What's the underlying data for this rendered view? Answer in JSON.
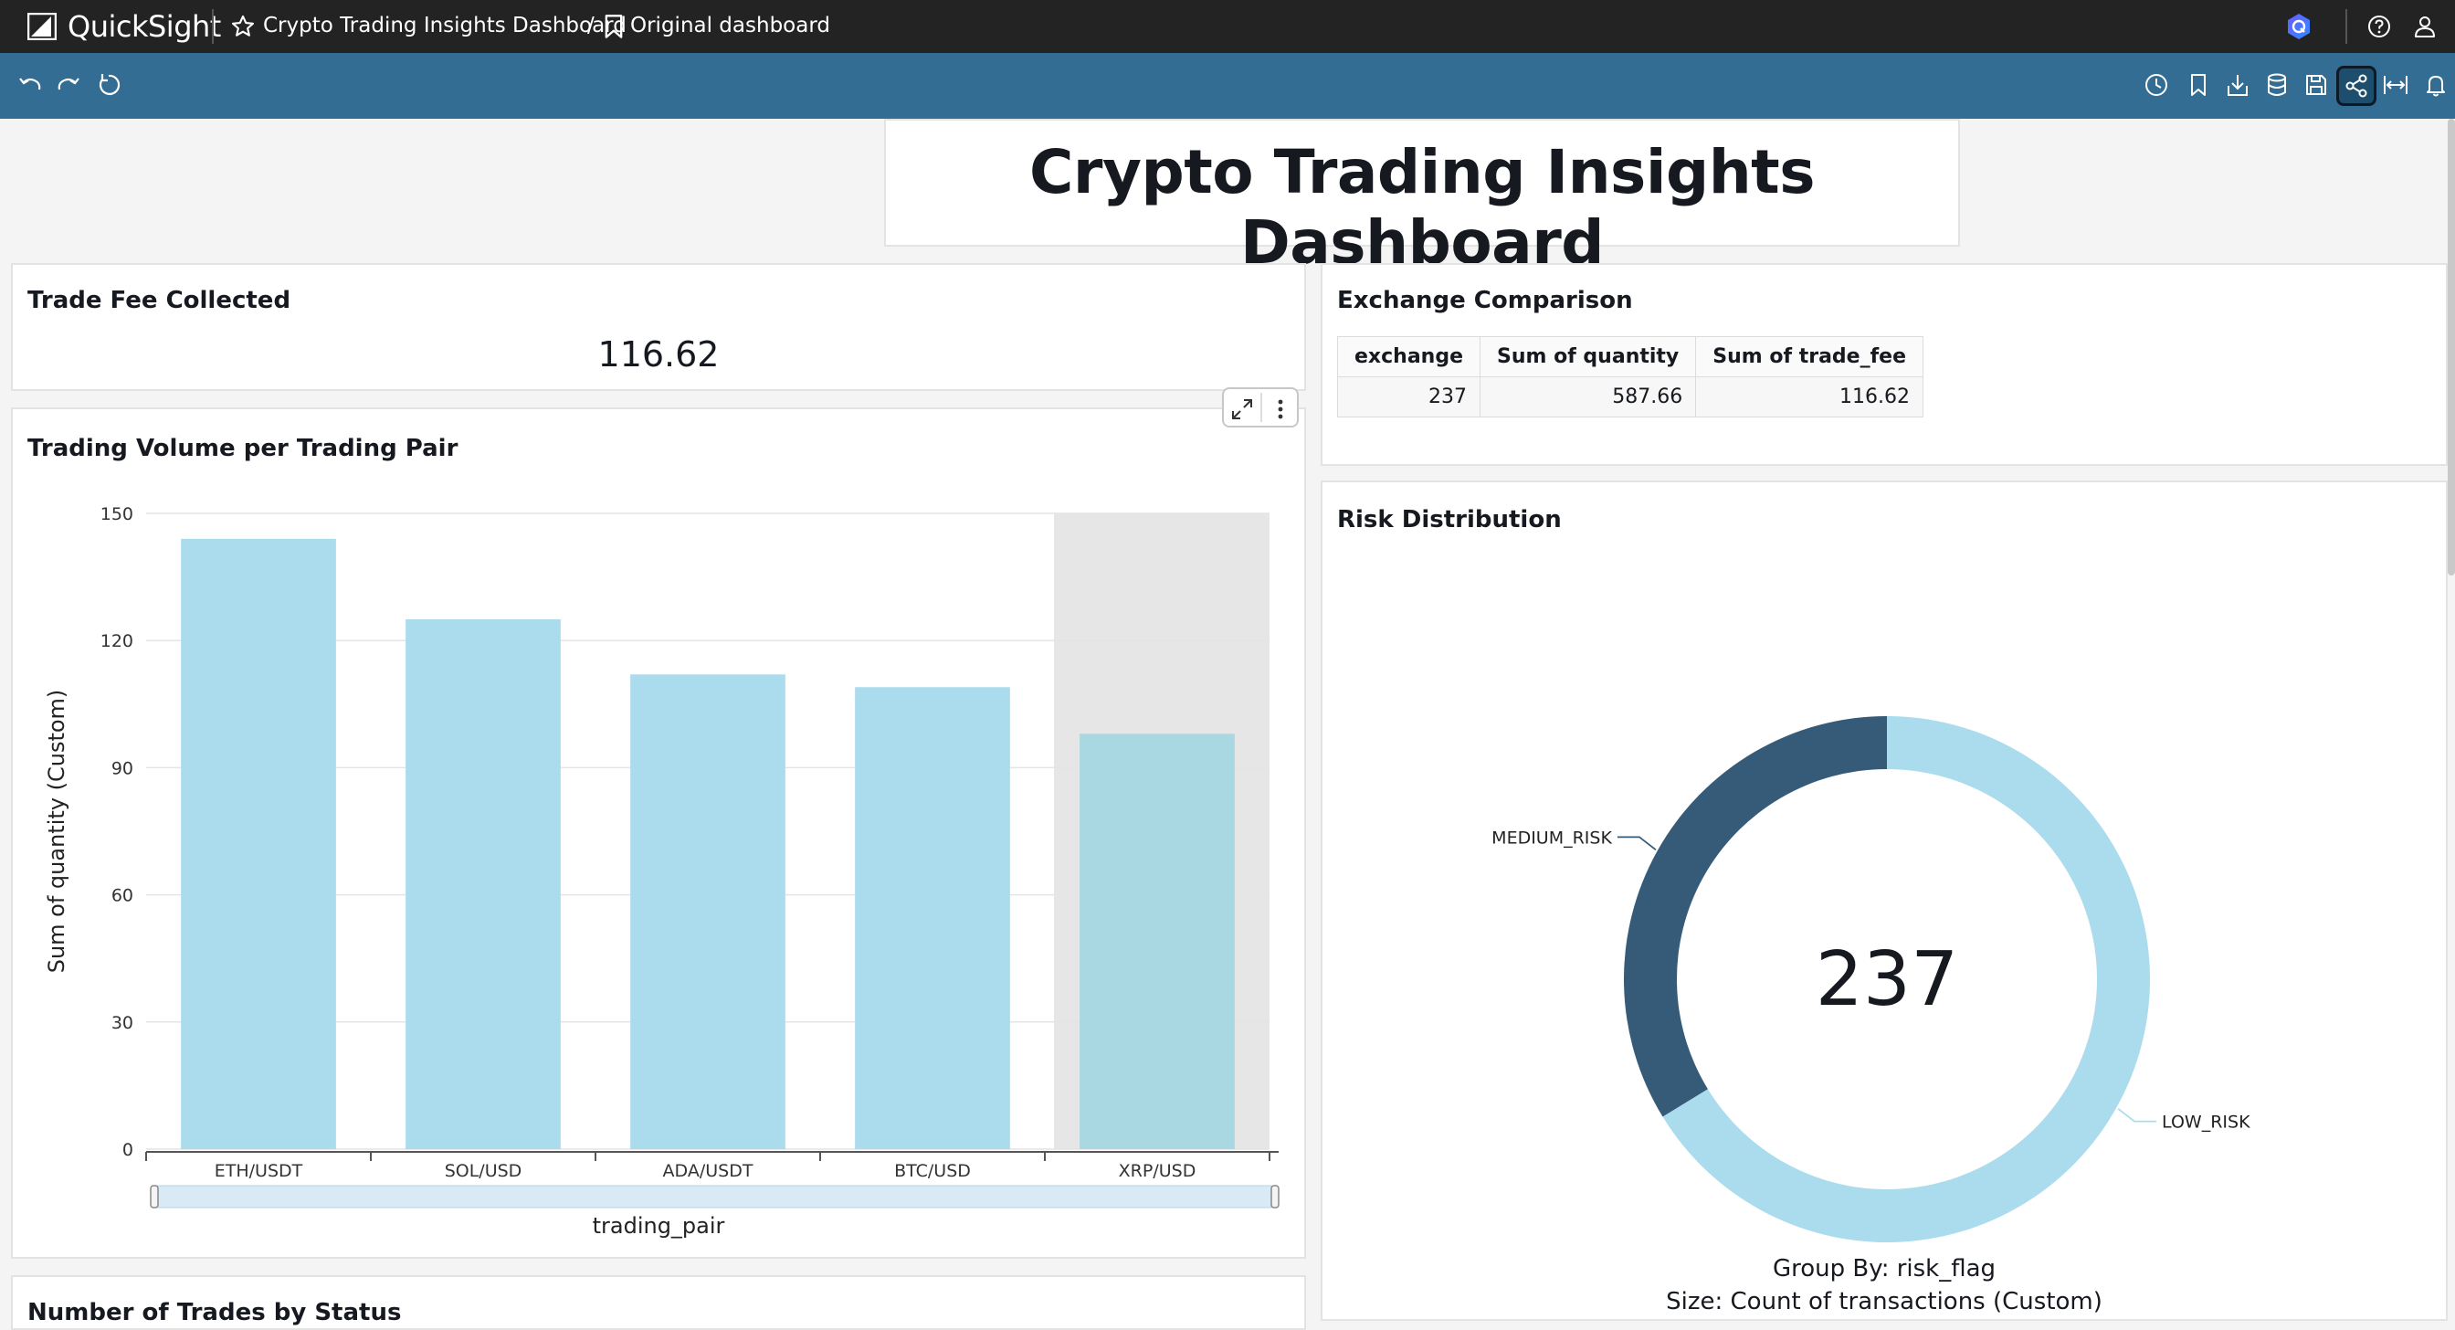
{
  "app": {
    "name": "QuickSight"
  },
  "breadcrumb": {
    "analysis_name": "Crypto Trading Insights Dashboard",
    "separator": "/",
    "sheet_name": "Original dashboard"
  },
  "header_icons": [
    "favorite-star-icon",
    "bookmark-icon",
    "amazon-q-icon",
    "help-icon",
    "user-icon"
  ],
  "toolbar_icons": [
    "undo-icon",
    "redo-icon",
    "reset-icon",
    "schedule-icon",
    "bookmark-icon",
    "export-icon",
    "dataset-icon",
    "save-icon",
    "share-icon",
    "fit-width-icon",
    "alert-icon"
  ],
  "dashboard": {
    "title": "Crypto Trading Insights Dashboard"
  },
  "kpi": {
    "title": "Trade Fee Collected",
    "value": "116.62"
  },
  "exchange_table": {
    "title": "Exchange Comparison",
    "columns": [
      "exchange",
      "Sum of quantity",
      "Sum of trade_fee"
    ],
    "rows": [
      [
        "237",
        "587.66",
        "116.62"
      ]
    ]
  },
  "bar_visual": {
    "title": "Trading Volume per Trading Pair",
    "controls": [
      "expand-icon",
      "more-options-icon"
    ]
  },
  "risk_visual": {
    "title": "Risk Distribution",
    "center_value": "237",
    "group_by_text": "Group By: risk_flag",
    "size_text": "Size: Count of transactions (Custom)"
  },
  "next_panel": {
    "title": "Number of Trades by Status"
  },
  "chart_data": [
    {
      "type": "bar",
      "title": "Trading Volume per Trading Pair",
      "categories": [
        "ETH/USDT",
        "SOL/USD",
        "ADA/USDT",
        "BTC/USD",
        "XRP/USD"
      ],
      "values": [
        144,
        125,
        112,
        109,
        98
      ],
      "xlabel": "trading_pair",
      "ylabel": "Sum of quantity (Custom)",
      "ylim": [
        0,
        150
      ],
      "yticks": [
        0,
        30,
        60,
        90,
        120,
        150
      ],
      "highlighted_category": "XRP/USD",
      "grid": true,
      "colors": {
        "bar": "#abdcee",
        "highlight_bar": "#a9d8e2",
        "highlight_band": "#e6e6e6"
      }
    },
    {
      "type": "pie",
      "title": "Risk Distribution",
      "donut": true,
      "categories": [
        "LOW_RISK",
        "MEDIUM_RISK"
      ],
      "values": [
        157,
        80
      ],
      "total": 237,
      "colors": {
        "LOW_RISK": "#abdcee",
        "MEDIUM_RISK": "#355b78"
      }
    }
  ],
  "colors": {
    "header": "#232323",
    "toolbar": "#336d94"
  }
}
